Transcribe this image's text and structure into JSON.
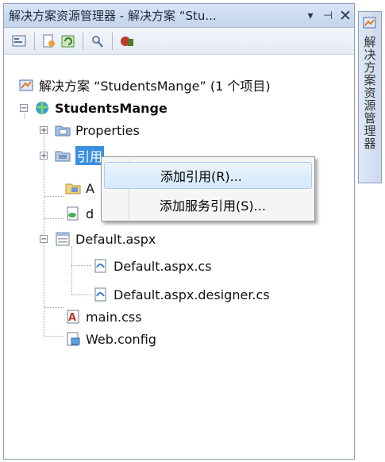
{
  "window": {
    "title": "解决方案资源管理器 - 解决方案 “Stu...",
    "pin_glyph": "▾",
    "autohide_glyph": "⊣",
    "close_glyph": "✕"
  },
  "toolbar": {
    "buttons": [
      "properties-icon",
      "show-all-files-icon",
      "refresh-icon",
      "view-class-diagram-icon",
      "wcf-config-icon"
    ]
  },
  "tree": {
    "solution": "解决方案 “StudentsMange” (1 个项目)",
    "project": "StudentsMange",
    "items": {
      "properties": "Properties",
      "references": "引用",
      "app_data": "A",
      "db": "d",
      "default_aspx": "Default.aspx",
      "default_cs": "Default.aspx.cs",
      "default_designer": "Default.aspx.designer.cs",
      "main_css": "main.css",
      "web_config": "Web.config"
    }
  },
  "context_menu": {
    "items": [
      "添加引用(R)...",
      "添加服务引用(S)..."
    ],
    "highlighted_index": 0
  },
  "side_tab": {
    "label": "解决方案资源管理器"
  }
}
